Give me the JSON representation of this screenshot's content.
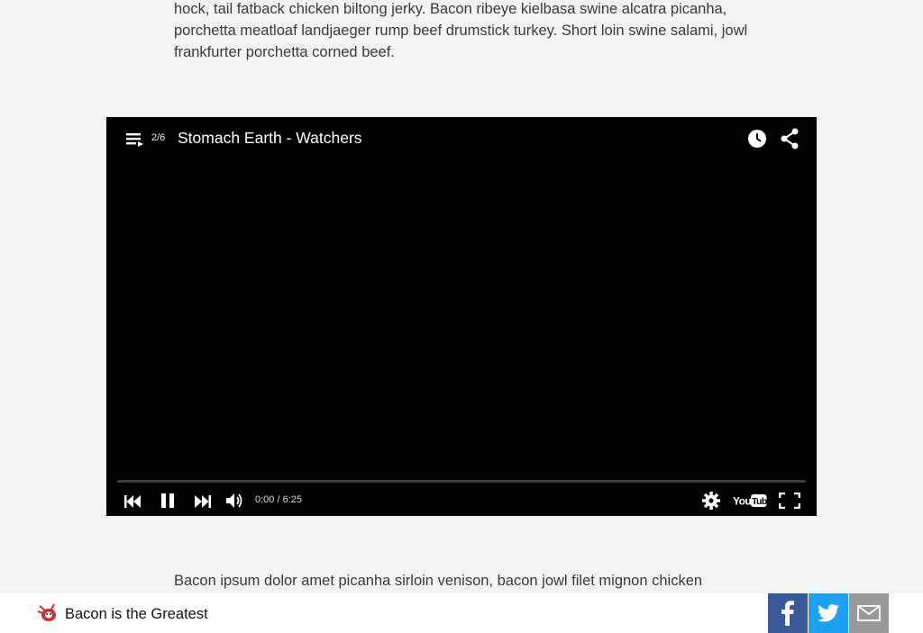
{
  "article": {
    "paragraph_top": "hock, tail fatback chicken biltong jerky. Bacon ribeye kielbasa swine alcatra picanha, porchetta meatloaf landjaeger rump beef drumstick turkey. Short loin swine salami, jowl frankfurter porchetta corned beef.",
    "paragraph_bottom": "Bacon ipsum dolor amet picanha sirloin venison, bacon jowl filet mignon chicken"
  },
  "player": {
    "playlist_index": "2/6",
    "title": "Stomach Earth - Watchers",
    "time": "0:00 / 6:25",
    "progress": 0,
    "icons": [
      "playlist-icon",
      "clock-icon",
      "share-icon",
      "previous-icon",
      "pause-icon",
      "next-icon",
      "volume-icon",
      "settings-icon",
      "youtube-logo",
      "fullscreen-icon"
    ]
  },
  "footer": {
    "site_name": "Bacon is the Greatest",
    "share": {
      "facebook_label": "f",
      "colors": {
        "facebook": "#3b5998",
        "twitter": "#1da1f2",
        "email": "#999999"
      }
    }
  }
}
